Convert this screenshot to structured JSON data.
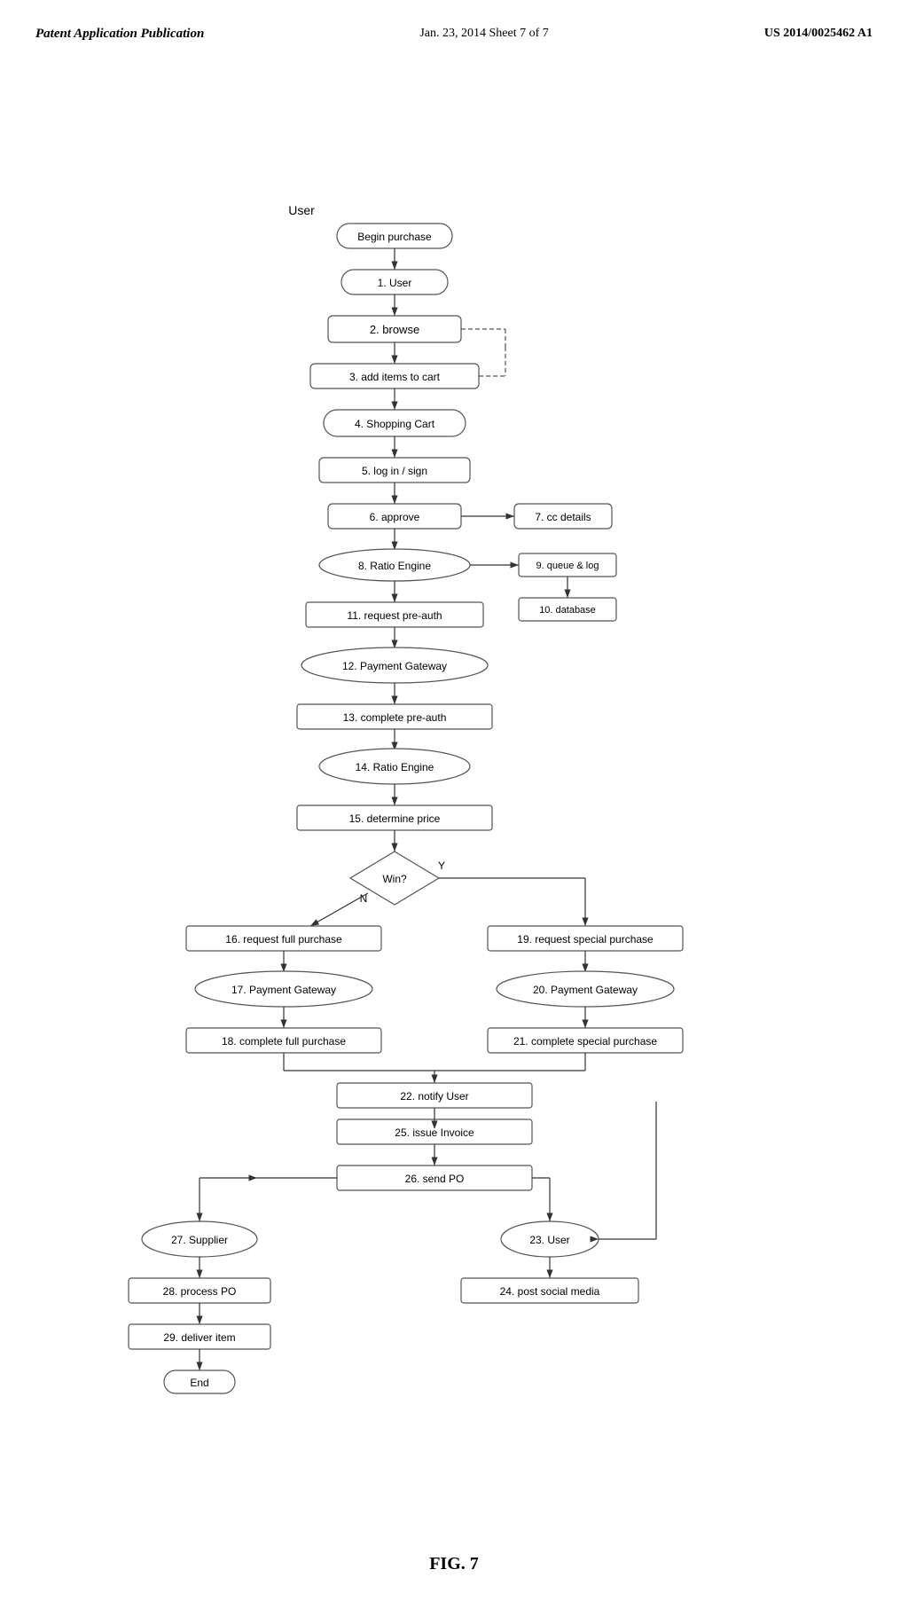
{
  "header": {
    "left": "Patent Application Publication",
    "center_line1": "Jan. 23, 2014  Sheet 7 of 7",
    "right": "US 2014/0025462 A1"
  },
  "fig_label": "FIG. 7",
  "nodes": {
    "begin_purchase": "Begin purchase",
    "n1": "1. User",
    "n2": "2. browse",
    "n3": "3. add items to cart",
    "n4": "4. Shopping Cart",
    "n5": "5. log in / sign",
    "n6": "6. approve",
    "n7": "7. cc details",
    "n8": "8. Ratio Engine",
    "n9": "9. queue & log",
    "n10": "10. database",
    "n11": "11. request pre-auth",
    "n12": "12. Payment Gateway",
    "n13": "13. complete pre-auth",
    "n14": "14. Ratio Engine",
    "n15": "15. determine price",
    "win_diamond": "Win?",
    "win_n": "N",
    "win_y": "Y",
    "n16": "16. request full purchase",
    "n17": "17. Payment Gateway",
    "n18": "18. complete full purchase",
    "n19": "19. request special purchase",
    "n20": "20. Payment Gateway",
    "n21": "21. complete special purchase",
    "n22": "22. notify User",
    "n23": "23. User",
    "n24": "24. post social media",
    "n25": "25. issue Invoice",
    "n26": "26. send PO",
    "n27": "27. Supplier",
    "n28": "28. process PO",
    "n29": "29. deliver item",
    "end": "End",
    "user_label": "User"
  }
}
